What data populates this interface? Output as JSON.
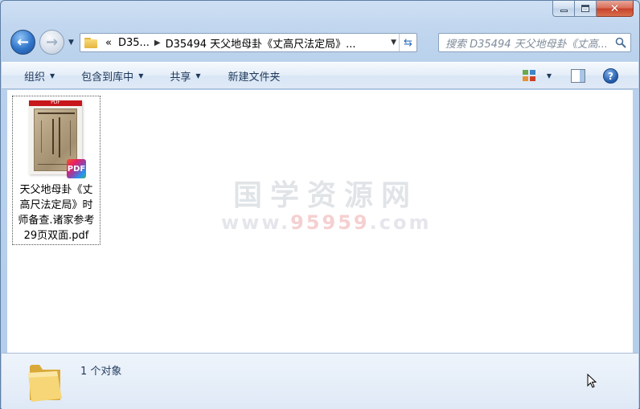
{
  "window": {
    "minimize_label": "minimize",
    "maximize_label": "maximize",
    "close_label": "✕"
  },
  "nav": {
    "breadcrumb": [
      "«",
      "D35...",
      "D35494 天父地母卦《丈高尺法定局》..."
    ],
    "search_placeholder": "搜索 D35494 天父地母卦《丈高..."
  },
  "toolbar": {
    "organize": "组织",
    "include_in_library": "包含到库中",
    "share": "共享",
    "new_folder": "新建文件夹"
  },
  "thumbnail": {
    "band_label": "PDF",
    "badge_label": "PDF"
  },
  "files": [
    {
      "name_lines": [
        "天父地母卦《丈",
        "高尺法定局》时",
        "师备查.诸家参考",
        "29页双面.pdf"
      ]
    }
  ],
  "watermark": {
    "title": "国学资源网",
    "url_prefix": "www.",
    "url_mid": "95959",
    "url_suffix": ".com"
  },
  "status": {
    "count_text": "1 个对象"
  },
  "colors": {
    "accent_blue": "#2f74c9",
    "close_red": "#c7412a",
    "folder_yellow": "#f8dc79"
  },
  "icons": {
    "back": "back-arrow-icon",
    "forward": "forward-arrow-icon",
    "refresh": "refresh-icon",
    "search": "search-icon",
    "help": "help-icon",
    "views": "view-options-icon",
    "preview_pane": "preview-pane-icon",
    "folder": "folder-icon",
    "pdf": "pdf-icon"
  }
}
